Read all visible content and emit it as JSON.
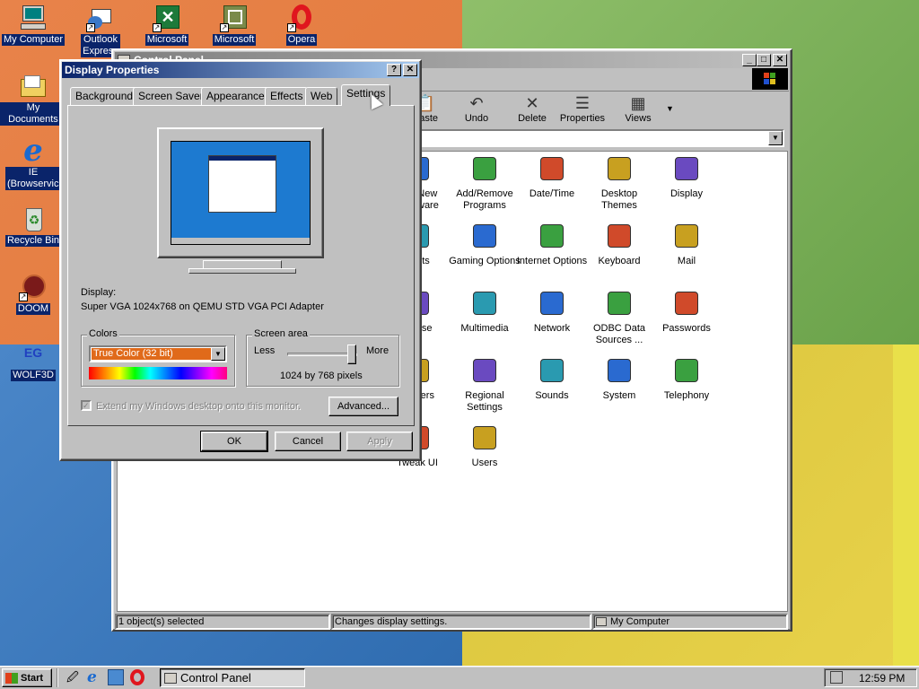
{
  "desktop": {
    "icons": [
      {
        "label": "My Computer",
        "icon": "my-computer-icon"
      },
      {
        "label": "Outlook Express",
        "icon": "outlook-express-icon"
      },
      {
        "label": "Microsoft",
        "icon": "excel-icon"
      },
      {
        "label": "Microsoft",
        "icon": "ms-app-icon"
      },
      {
        "label": "Opera",
        "icon": "opera-icon"
      },
      {
        "label": "My Documents",
        "icon": "folder-icon"
      },
      {
        "label": "IE (Browservice)",
        "icon": "ie-icon"
      },
      {
        "label": "Recycle Bin",
        "icon": "recycle-bin-icon"
      },
      {
        "label": "DOOM",
        "icon": "doom-icon"
      },
      {
        "label": "WOLF3D",
        "icon": "wolf3d-icon"
      }
    ]
  },
  "control_panel": {
    "title": "Control Panel",
    "toolbar": [
      {
        "label": "Paste",
        "icon": "paste-icon"
      },
      {
        "label": "Undo",
        "icon": "undo-icon"
      },
      {
        "label": "Delete",
        "icon": "delete-icon"
      },
      {
        "label": "Properties",
        "icon": "properties-icon"
      },
      {
        "label": "Views",
        "icon": "views-icon"
      }
    ],
    "items": [
      {
        "label": "Add New Hardware",
        "icon": "add-hardware-icon"
      },
      {
        "label": "Add/Remove Programs",
        "icon": "add-remove-programs-icon"
      },
      {
        "label": "Date/Time",
        "icon": "date-time-icon"
      },
      {
        "label": "Desktop Themes",
        "icon": "desktop-themes-icon"
      },
      {
        "label": "Display",
        "icon": "display-icon"
      },
      {
        "label": "Fonts",
        "icon": "fonts-icon"
      },
      {
        "label": "Gaming Options",
        "icon": "gaming-options-icon"
      },
      {
        "label": "Internet Options",
        "icon": "internet-options-icon"
      },
      {
        "label": "Keyboard",
        "icon": "keyboard-icon"
      },
      {
        "label": "Mail",
        "icon": "mail-icon"
      },
      {
        "label": "Mouse",
        "icon": "mouse-icon"
      },
      {
        "label": "Multimedia",
        "icon": "multimedia-icon"
      },
      {
        "label": "Network",
        "icon": "network-icon"
      },
      {
        "label": "ODBC Data Sources ...",
        "icon": "odbc-icon"
      },
      {
        "label": "Passwords",
        "icon": "passwords-icon"
      },
      {
        "label": "Printers",
        "icon": "printers-icon"
      },
      {
        "label": "Regional Settings",
        "icon": "regional-settings-icon"
      },
      {
        "label": "Sounds",
        "icon": "sounds-icon"
      },
      {
        "label": "System",
        "icon": "system-icon"
      },
      {
        "label": "Telephony",
        "icon": "telephony-icon"
      },
      {
        "label": "Tweak UI",
        "icon": "tweakui-icon"
      },
      {
        "label": "Users",
        "icon": "users-icon"
      }
    ],
    "status": {
      "selected": "1 object(s) selected",
      "description": "Changes display settings.",
      "location": "My Computer"
    }
  },
  "display_properties": {
    "title": "Display Properties",
    "help_button": "?",
    "close_button": "✕",
    "tabs": [
      "Background",
      "Screen Saver",
      "Appearance",
      "Effects",
      "Web",
      "Settings"
    ],
    "active_tab": "Settings",
    "display_label": "Display:",
    "display_value": "Super VGA 1024x768 on QEMU STD VGA PCI Adapter",
    "colors_label": "Colors",
    "colors_value": "True Color (32 bit)",
    "screen_area_label": "Screen area",
    "less_label": "Less",
    "more_label": "More",
    "resolution": "1024 by 768 pixels",
    "slider_position": 0.95,
    "extend_label": "Extend my Windows desktop onto this monitor.",
    "advanced_button": "Advanced...",
    "ok_button": "OK",
    "cancel_button": "Cancel",
    "apply_button": "Apply"
  },
  "taskbar": {
    "start_label": "Start",
    "task_label": "Control Panel",
    "clock": "12:59 PM"
  }
}
